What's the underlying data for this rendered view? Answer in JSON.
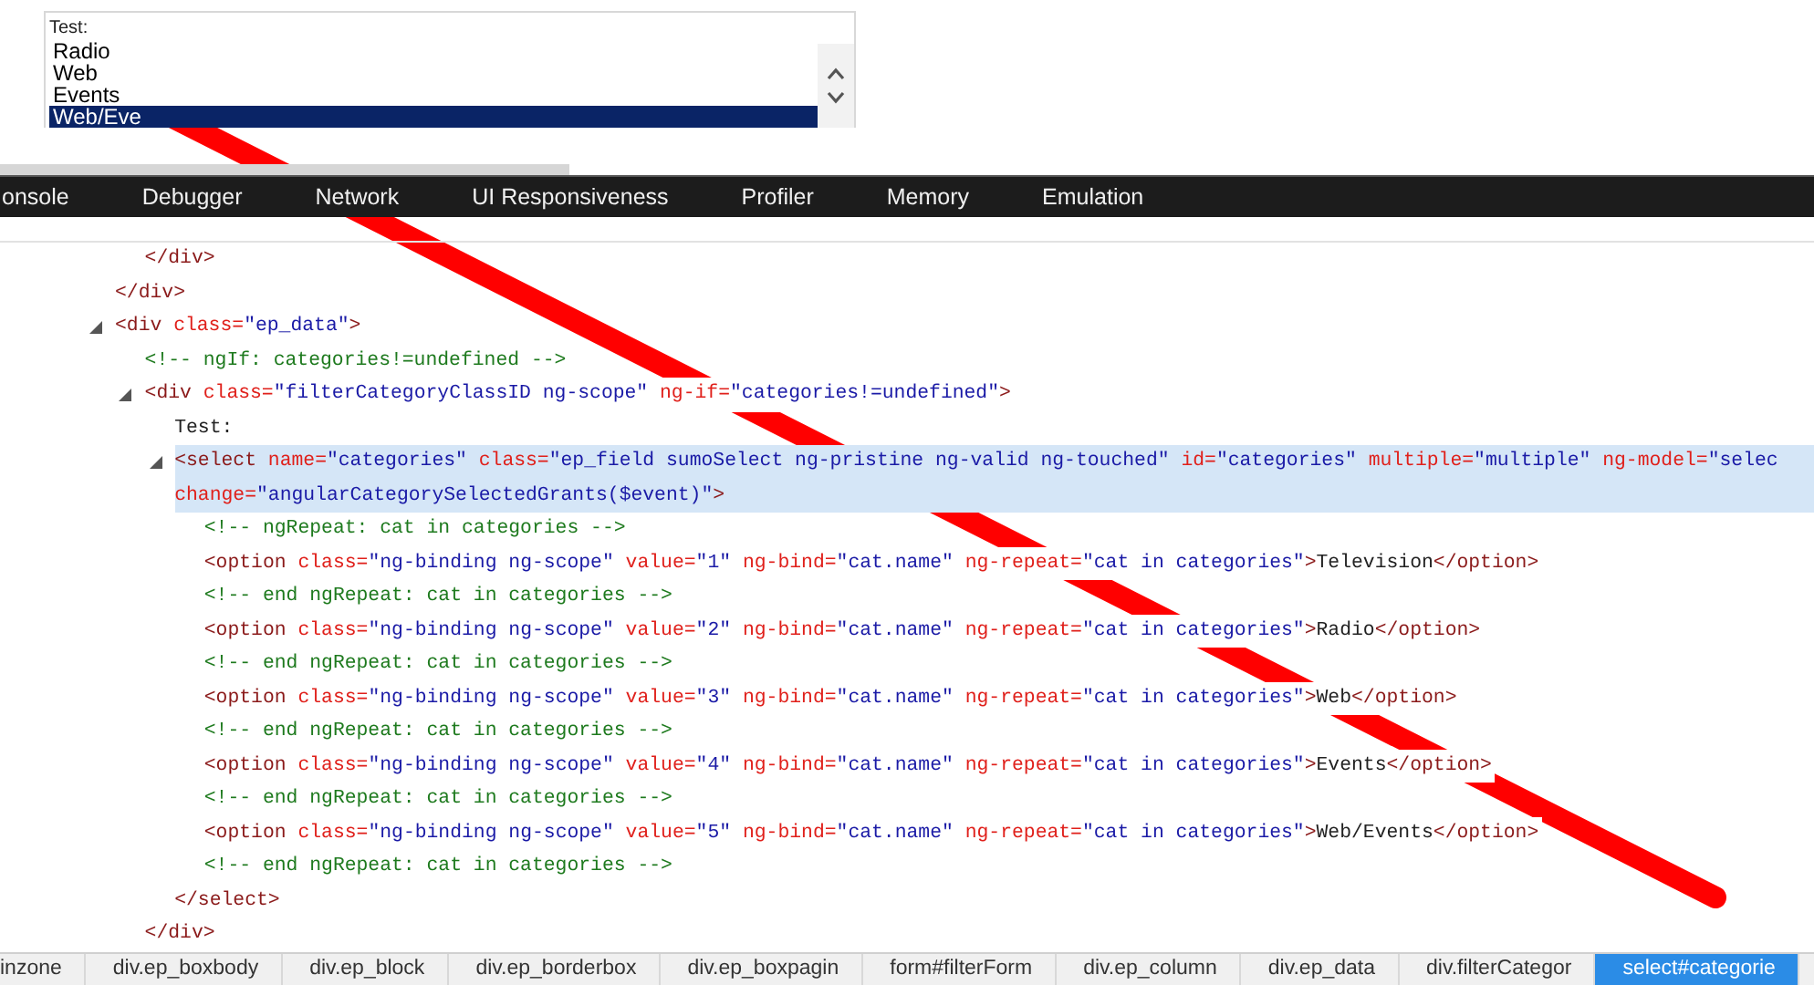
{
  "preview": {
    "label": "Test:",
    "options": [
      {
        "text": "Radio",
        "selected": false
      },
      {
        "text": "Web",
        "selected": false
      },
      {
        "text": "Events",
        "selected": false
      },
      {
        "text": "Web/Eve",
        "selected": true
      }
    ]
  },
  "tabs": [
    {
      "label": "onsole",
      "selected": false
    },
    {
      "label": "Debugger",
      "selected": false
    },
    {
      "label": "Network",
      "selected": false
    },
    {
      "label": "UI Responsiveness",
      "selected": false
    },
    {
      "label": "Profiler",
      "selected": false
    },
    {
      "label": "Memory",
      "selected": false
    },
    {
      "label": "Emulation",
      "selected": false
    }
  ],
  "dom_tree": [
    {
      "children": [
        {
          "closing": [
            {
              "kind": "tag",
              "text": "</div>"
            }
          ]
        }
      ]
    },
    {
      "selected": false,
      "lines": [
        [
          {
            "kind": "tag",
            "text": "</div>"
          }
        ]
      ]
    },
    {
      "selected": false,
      "expanded": true,
      "lines": [
        [
          {
            "kind": "tag",
            "text": "<div"
          },
          {
            "kind": "attr",
            "text": " class="
          },
          {
            "kind": "val",
            "text": "\"ep_data\""
          },
          {
            "kind": "tag",
            "text": ">"
          }
        ]
      ],
      "children": [
        {
          "selected": false,
          "lines": [
            [
              {
                "kind": "comment",
                "text": "<!-- ngIf: categories!=undefined -->"
              }
            ]
          ]
        },
        {
          "selected": false,
          "expanded": true,
          "lines": [
            [
              {
                "kind": "tag",
                "text": "<div"
              },
              {
                "kind": "attr",
                "text": " class="
              },
              {
                "kind": "val",
                "text": "\"filterCategoryClassID ng-scope\""
              },
              {
                "kind": "attr",
                "text": " ng-if="
              },
              {
                "kind": "val",
                "text": "\"categories!=undefined\""
              },
              {
                "kind": "tag",
                "text": ">"
              }
            ]
          ],
          "closing": [
            {
              "kind": "tag",
              "text": "</div>"
            }
          ],
          "children": [
            {
              "selected": false,
              "lines": [
                [
                  {
                    "kind": "text",
                    "text": "Test:"
                  }
                ]
              ]
            },
            {
              "selected": true,
              "expanded": true,
              "lines": [
                [
                  {
                    "kind": "tag",
                    "text": "<select"
                  },
                  {
                    "kind": "attr",
                    "text": " name="
                  },
                  {
                    "kind": "val",
                    "text": "\"categories\""
                  },
                  {
                    "kind": "attr",
                    "text": " class="
                  },
                  {
                    "kind": "val",
                    "text": "\"ep_field sumoSelect ng-pristine ng-valid ng-touched\""
                  },
                  {
                    "kind": "attr",
                    "text": " id="
                  },
                  {
                    "kind": "val",
                    "text": "\"categories\""
                  },
                  {
                    "kind": "attr",
                    "text": " multiple="
                  },
                  {
                    "kind": "val",
                    "text": "\"multiple\""
                  },
                  {
                    "kind": "attr",
                    "text": " ng-model="
                  },
                  {
                    "kind": "val",
                    "text": "\"selec"
                  }
                ],
                [
                  {
                    "kind": "attr",
                    "text": "change="
                  },
                  {
                    "kind": "val",
                    "text": "\"angularCategorySelectedGrants($event)\""
                  },
                  {
                    "kind": "tag",
                    "text": ">"
                  }
                ]
              ],
              "closing": [
                {
                  "kind": "tag",
                  "text": "</select>"
                }
              ],
              "children": [
                {
                  "selected": false,
                  "lines": [
                    [
                      {
                        "kind": "comment",
                        "text": "<!-- ngRepeat: cat in categories -->"
                      }
                    ]
                  ]
                },
                {
                  "selected": false,
                  "lines": [
                    [
                      {
                        "kind": "tag",
                        "text": "<option"
                      },
                      {
                        "kind": "attr",
                        "text": " class="
                      },
                      {
                        "kind": "val",
                        "text": "\"ng-binding ng-scope\""
                      },
                      {
                        "kind": "attr",
                        "text": " value="
                      },
                      {
                        "kind": "val",
                        "text": "\"1\""
                      },
                      {
                        "kind": "attr",
                        "text": " ng-bind="
                      },
                      {
                        "kind": "val",
                        "text": "\"cat.name\""
                      },
                      {
                        "kind": "attr",
                        "text": " ng-repeat="
                      },
                      {
                        "kind": "val",
                        "text": "\"cat in categories\""
                      },
                      {
                        "kind": "tag",
                        "text": ">"
                      },
                      {
                        "kind": "text",
                        "text": "Television"
                      },
                      {
                        "kind": "tag",
                        "text": "</option>"
                      }
                    ]
                  ]
                },
                {
                  "selected": false,
                  "lines": [
                    [
                      {
                        "kind": "comment",
                        "text": "<!-- end ngRepeat: cat in categories -->"
                      }
                    ]
                  ]
                },
                {
                  "selected": false,
                  "lines": [
                    [
                      {
                        "kind": "tag",
                        "text": "<option"
                      },
                      {
                        "kind": "attr",
                        "text": " class="
                      },
                      {
                        "kind": "val",
                        "text": "\"ng-binding ng-scope\""
                      },
                      {
                        "kind": "attr",
                        "text": " value="
                      },
                      {
                        "kind": "val",
                        "text": "\"2\""
                      },
                      {
                        "kind": "attr",
                        "text": " ng-bind="
                      },
                      {
                        "kind": "val",
                        "text": "\"cat.name\""
                      },
                      {
                        "kind": "attr",
                        "text": " ng-repeat="
                      },
                      {
                        "kind": "val",
                        "text": "\"cat in categories\""
                      },
                      {
                        "kind": "tag",
                        "text": ">"
                      },
                      {
                        "kind": "text",
                        "text": "Radio"
                      },
                      {
                        "kind": "tag",
                        "text": "</option>"
                      }
                    ]
                  ]
                },
                {
                  "selected": false,
                  "lines": [
                    [
                      {
                        "kind": "comment",
                        "text": "<!-- end ngRepeat: cat in categories -->"
                      }
                    ]
                  ]
                },
                {
                  "selected": false,
                  "lines": [
                    [
                      {
                        "kind": "tag",
                        "text": "<option"
                      },
                      {
                        "kind": "attr",
                        "text": " class="
                      },
                      {
                        "kind": "val",
                        "text": "\"ng-binding ng-scope\""
                      },
                      {
                        "kind": "attr",
                        "text": " value="
                      },
                      {
                        "kind": "val",
                        "text": "\"3\""
                      },
                      {
                        "kind": "attr",
                        "text": " ng-bind="
                      },
                      {
                        "kind": "val",
                        "text": "\"cat.name\""
                      },
                      {
                        "kind": "attr",
                        "text": " ng-repeat="
                      },
                      {
                        "kind": "val",
                        "text": "\"cat in categories\""
                      },
                      {
                        "kind": "tag",
                        "text": ">"
                      },
                      {
                        "kind": "text",
                        "text": "Web"
                      },
                      {
                        "kind": "tag",
                        "text": "</option>"
                      }
                    ]
                  ]
                },
                {
                  "selected": false,
                  "lines": [
                    [
                      {
                        "kind": "comment",
                        "text": "<!-- end ngRepeat: cat in categories -->"
                      }
                    ]
                  ]
                },
                {
                  "selected": false,
                  "lines": [
                    [
                      {
                        "kind": "tag",
                        "text": "<option"
                      },
                      {
                        "kind": "attr",
                        "text": " class="
                      },
                      {
                        "kind": "val",
                        "text": "\"ng-binding ng-scope\""
                      },
                      {
                        "kind": "attr",
                        "text": " value="
                      },
                      {
                        "kind": "val",
                        "text": "\"4\""
                      },
                      {
                        "kind": "attr",
                        "text": " ng-bind="
                      },
                      {
                        "kind": "val",
                        "text": "\"cat.name\""
                      },
                      {
                        "kind": "attr",
                        "text": " ng-repeat="
                      },
                      {
                        "kind": "val",
                        "text": "\"cat in categories\""
                      },
                      {
                        "kind": "tag",
                        "text": ">"
                      },
                      {
                        "kind": "text",
                        "text": "Events"
                      },
                      {
                        "kind": "tag",
                        "text": "</option>"
                      }
                    ]
                  ]
                },
                {
                  "selected": false,
                  "lines": [
                    [
                      {
                        "kind": "comment",
                        "text": "<!-- end ngRepeat: cat in categories -->"
                      }
                    ]
                  ]
                },
                {
                  "selected": false,
                  "lines": [
                    [
                      {
                        "kind": "tag",
                        "text": "<option"
                      },
                      {
                        "kind": "attr",
                        "text": " class="
                      },
                      {
                        "kind": "val",
                        "text": "\"ng-binding ng-scope\""
                      },
                      {
                        "kind": "attr",
                        "text": " value="
                      },
                      {
                        "kind": "val",
                        "text": "\"5\""
                      },
                      {
                        "kind": "attr",
                        "text": " ng-bind="
                      },
                      {
                        "kind": "val",
                        "text": "\"cat.name\""
                      },
                      {
                        "kind": "attr",
                        "text": " ng-repeat="
                      },
                      {
                        "kind": "val",
                        "text": "\"cat in categories\""
                      },
                      {
                        "kind": "tag",
                        "text": ">"
                      },
                      {
                        "kind": "text",
                        "text": "Web/Events"
                      },
                      {
                        "kind": "tag",
                        "text": "</option>"
                      }
                    ]
                  ]
                },
                {
                  "selected": false,
                  "lines": [
                    [
                      {
                        "kind": "comment",
                        "text": "<!-- end ngRepeat: cat in categories -->"
                      }
                    ]
                  ]
                }
              ]
            }
          ]
        }
      ]
    }
  ],
  "breadcrumbs": [
    {
      "label": "inzone",
      "selected": false
    },
    {
      "label": "div.ep_boxbody",
      "selected": false
    },
    {
      "label": "div.ep_block",
      "selected": false
    },
    {
      "label": "div.ep_borderbox",
      "selected": false
    },
    {
      "label": "div.ep_boxpagin",
      "selected": false
    },
    {
      "label": "form#filterForm",
      "selected": false
    },
    {
      "label": "div.ep_column",
      "selected": false
    },
    {
      "label": "div.ep_data",
      "selected": false
    },
    {
      "label": "div.filterCategor",
      "selected": false
    },
    {
      "label": "select#categorie",
      "selected": true
    }
  ],
  "overlay": {
    "kind": "stroke"
  }
}
